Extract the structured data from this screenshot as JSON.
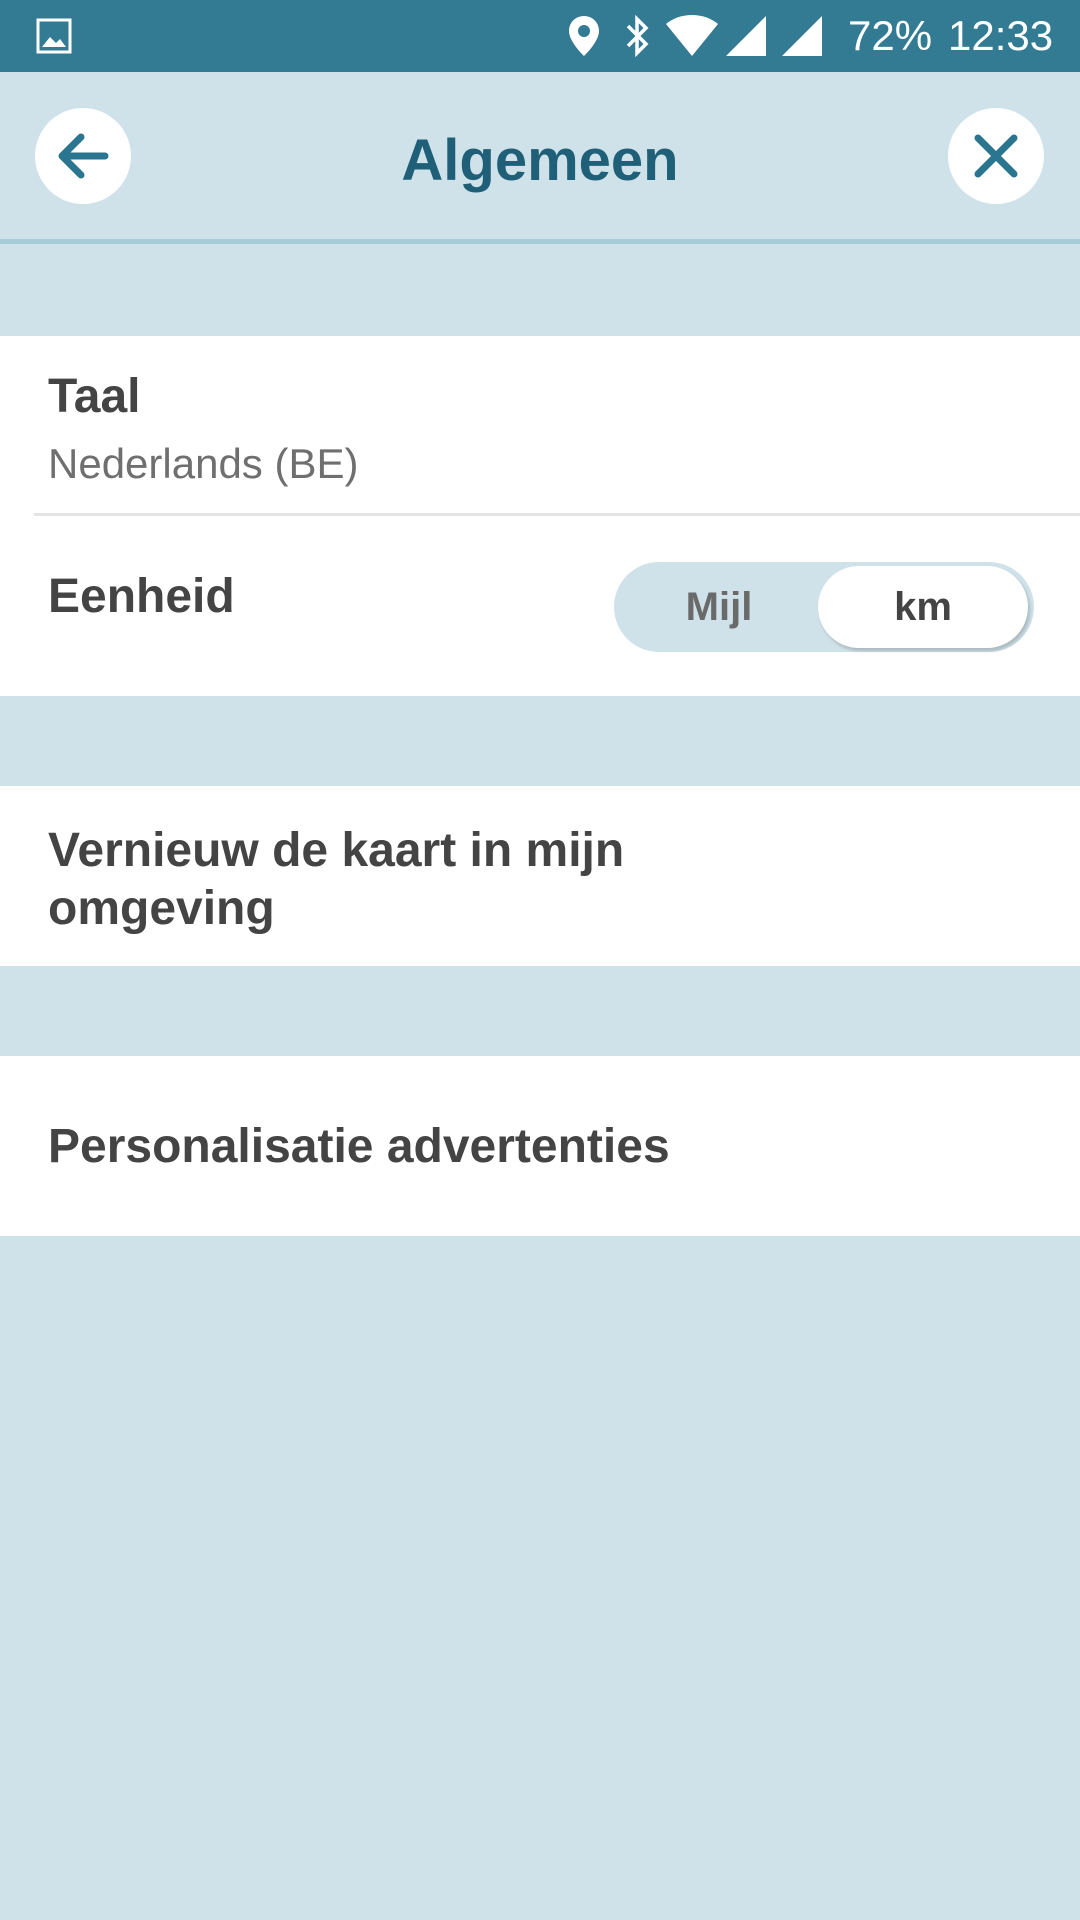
{
  "status_bar": {
    "battery": "72%",
    "time": "12:33",
    "icons": [
      "gallery-icon",
      "location-icon",
      "bluetooth-icon",
      "wifi-icon",
      "signal-icon",
      "signal-icon"
    ]
  },
  "header": {
    "title": "Algemeen",
    "back_icon": "arrow-left-icon",
    "close_icon": "close-icon"
  },
  "settings": {
    "language": {
      "label": "Taal",
      "value": "Nederlands (BE)"
    },
    "unit": {
      "label": "Eenheid",
      "options": [
        "Mijl",
        "km"
      ],
      "selected": "km"
    },
    "refresh_map": {
      "label_line1": "Vernieuw de kaart in mijn",
      "label_line2": "omgeving"
    },
    "ads": {
      "label": "Personalisatie advertenties"
    }
  },
  "colors": {
    "status_bar": "#337b93",
    "background": "#cfe2e9",
    "title": "#1f5f78",
    "icon": "#2a7590",
    "text": "#444444"
  }
}
